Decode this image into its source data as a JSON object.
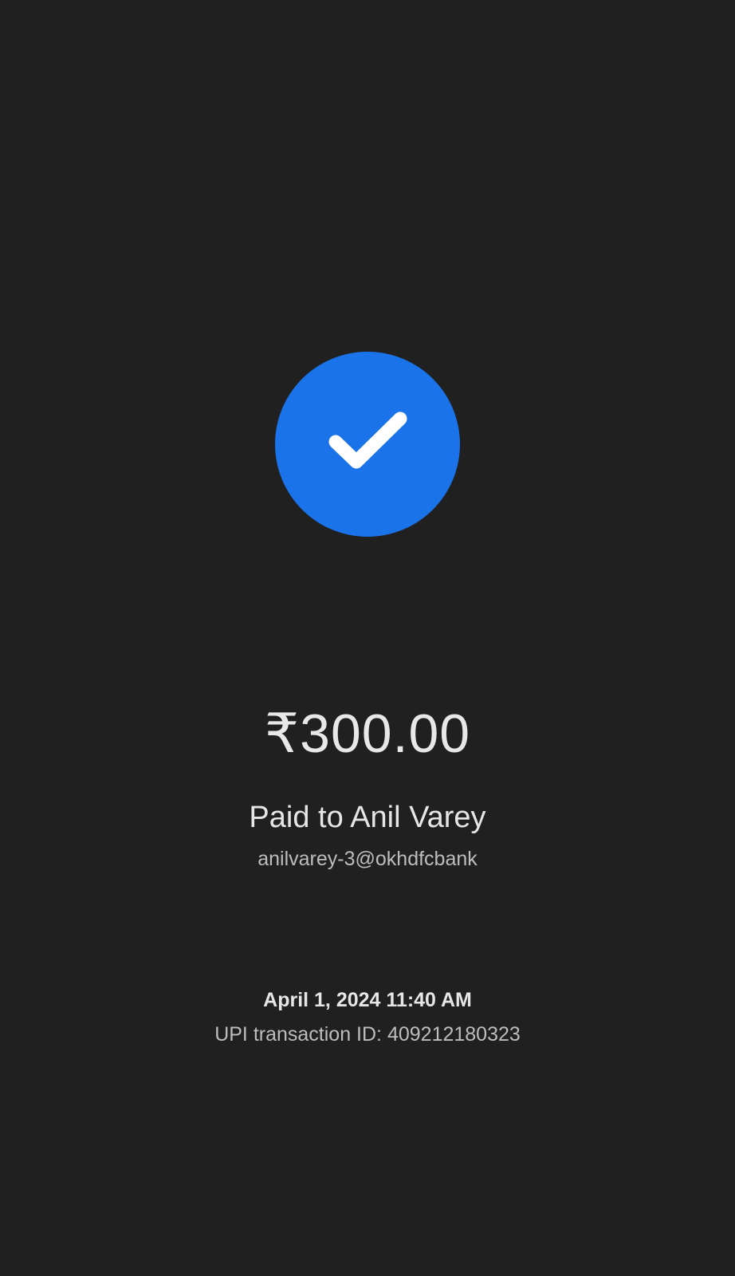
{
  "status": {
    "icon": "checkmark-icon",
    "accent_color": "#1a73e8"
  },
  "payment": {
    "amount": "₹300.00",
    "paid_to": "Paid to Anil Varey",
    "upi_id": "anilvarey-3@okhdfcbank",
    "datetime": "April 1, 2024 11:40 AM",
    "transaction_id": "UPI transaction ID: 409212180323"
  }
}
